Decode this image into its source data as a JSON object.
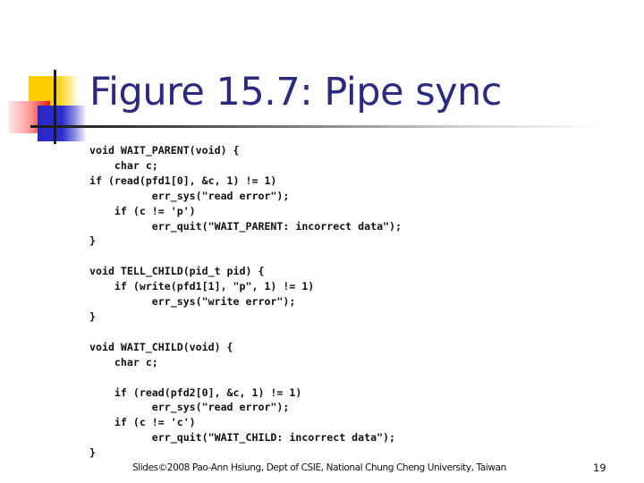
{
  "slide": {
    "title": "Figure 15.7: Pipe sync",
    "code_lines": [
      "void WAIT_PARENT(void) {",
      "    char c;",
      "if (read(pfd1[0], &c, 1) != 1)",
      "          err_sys(\"read error\");",
      "    if (c != 'p')",
      "          err_quit(\"WAIT_PARENT: incorrect data\");",
      "}",
      "",
      "void TELL_CHILD(pid_t pid) {",
      "    if (write(pfd1[1], \"p\", 1) != 1)",
      "          err_sys(\"write error\");",
      "}",
      "",
      "void WAIT_CHILD(void) {",
      "    char c;",
      "",
      "    if (read(pfd2[0], &c, 1) != 1)",
      "          err_sys(\"read error\");",
      "    if (c != 'c')",
      "          err_quit(\"WAIT_CHILD: incorrect data\");",
      "}"
    ],
    "footer": "Slides©2008 Pao-Ann Hsiung, Dept of CSIE, National Chung Cheng University, Taiwan",
    "page_number": "19"
  },
  "colors": {
    "title": "#2a2a80",
    "accent_yellow": "#ffcc00",
    "accent_red": "#f01818",
    "accent_blue": "#2828c8"
  }
}
